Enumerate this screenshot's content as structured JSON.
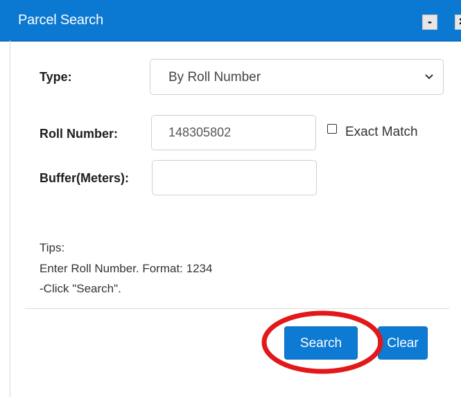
{
  "window": {
    "title": "Parcel Search",
    "minimize_label": "-",
    "close_label": "×"
  },
  "form": {
    "type_label": "Type:",
    "type_selected": "By Roll Number",
    "roll_label": "Roll Number:",
    "roll_value": "148305802",
    "exact_match_label": "Exact Match",
    "exact_match_checked": false,
    "buffer_label": "Buffer(Meters):",
    "buffer_value": ""
  },
  "tips": {
    "heading": "Tips:",
    "line1": "Enter Roll Number. Format: 1234",
    "line2": "-Click \"Search\"."
  },
  "buttons": {
    "search_label": "Search",
    "clear_label": "Clear"
  },
  "colors": {
    "titlebar": "#0b78d1",
    "button": "#0d7ad3",
    "highlight": "#e31818"
  },
  "icons": {
    "select_arrow": "chevron-down-icon",
    "annotation": "highlight-ellipse"
  }
}
